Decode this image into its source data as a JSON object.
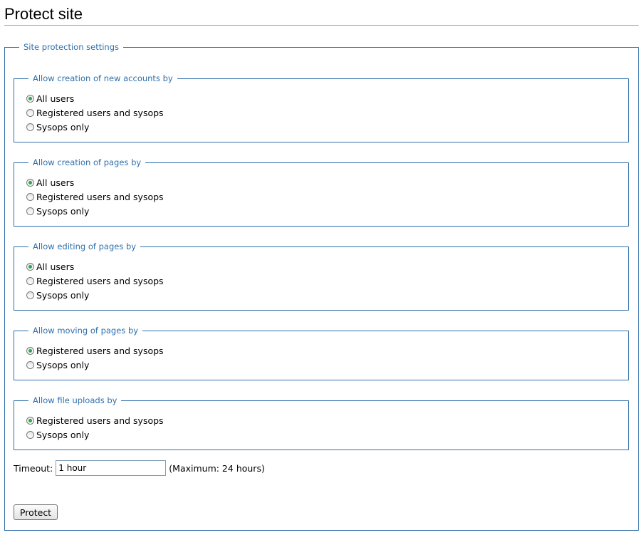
{
  "page": {
    "title": "Protect site"
  },
  "fieldset": {
    "legend": "Site protection settings"
  },
  "groups": [
    {
      "legend": "Allow creation of new accounts by",
      "options": [
        {
          "label": "All users",
          "checked": true
        },
        {
          "label": "Registered users and sysops",
          "checked": false
        },
        {
          "label": "Sysops only",
          "checked": false
        }
      ]
    },
    {
      "legend": "Allow creation of pages by",
      "options": [
        {
          "label": "All users",
          "checked": true
        },
        {
          "label": "Registered users and sysops",
          "checked": false
        },
        {
          "label": "Sysops only",
          "checked": false
        }
      ]
    },
    {
      "legend": "Allow editing of pages by",
      "options": [
        {
          "label": "All users",
          "checked": true
        },
        {
          "label": "Registered users and sysops",
          "checked": false
        },
        {
          "label": "Sysops only",
          "checked": false
        }
      ]
    },
    {
      "legend": "Allow moving of pages by",
      "options": [
        {
          "label": "Registered users and sysops",
          "checked": true
        },
        {
          "label": "Sysops only",
          "checked": false
        }
      ]
    },
    {
      "legend": "Allow file uploads by",
      "options": [
        {
          "label": "Registered users and sysops",
          "checked": true
        },
        {
          "label": "Sysops only",
          "checked": false
        }
      ]
    }
  ],
  "timeout": {
    "label": "Timeout:",
    "value": "1 hour",
    "note": "(Maximum: 24 hours)"
  },
  "submit": {
    "label": "Protect"
  },
  "colors": {
    "accent": "#2f6fab",
    "radio_checked": "#2aa84a"
  }
}
